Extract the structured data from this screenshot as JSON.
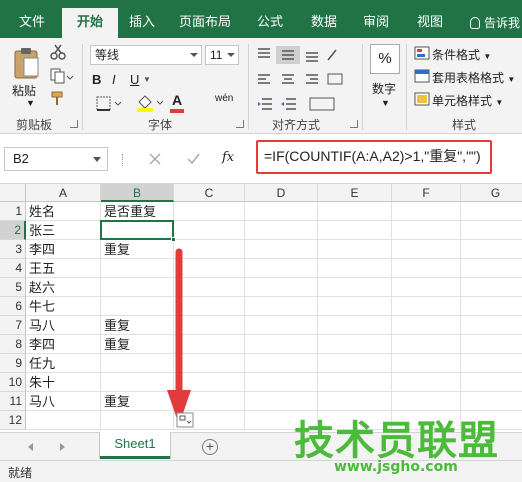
{
  "tabs": [
    "文件",
    "开始",
    "插入",
    "页面布局",
    "公式",
    "数据",
    "审阅",
    "视图"
  ],
  "tell_me": "告诉我",
  "ribbon": {
    "paste_label": "粘贴",
    "clipboard_label": "剪贴板",
    "font_name": "等线",
    "font_size": "11",
    "font_group_label": "字体",
    "bold": "B",
    "italic": "I",
    "underline": "U",
    "font_color": "A",
    "phonetic": "wén",
    "align_group_label": "对齐方式",
    "percent": "%",
    "number_label": "数字",
    "cond_format": "条件格式",
    "table_format": "套用表格格式",
    "cell_style": "单元格样式",
    "style_group_label": "样式",
    "fx": "fx"
  },
  "formula_bar": {
    "name_box": "B2",
    "formula": "=IF(COUNTIF(A:A,A2)>1,\"重复\",\"\")"
  },
  "columns": [
    "A",
    "B",
    "C",
    "D",
    "E",
    "F",
    "G"
  ],
  "rows": [
    {
      "num": "1",
      "a": "姓名",
      "b": "是否重复"
    },
    {
      "num": "2",
      "a": "张三",
      "b": ""
    },
    {
      "num": "3",
      "a": "李四",
      "b": "重复"
    },
    {
      "num": "4",
      "a": "王五",
      "b": ""
    },
    {
      "num": "5",
      "a": "赵六",
      "b": ""
    },
    {
      "num": "6",
      "a": "牛七",
      "b": ""
    },
    {
      "num": "7",
      "a": "马八",
      "b": "重复"
    },
    {
      "num": "8",
      "a": "李四",
      "b": "重复"
    },
    {
      "num": "9",
      "a": "任九",
      "b": ""
    },
    {
      "num": "10",
      "a": "朱十",
      "b": ""
    },
    {
      "num": "11",
      "a": "马八",
      "b": "重复"
    },
    {
      "num": "12",
      "a": "",
      "b": ""
    }
  ],
  "sheet_tab": "Sheet1",
  "add_sheet": "+",
  "status": "就绪",
  "watermark": {
    "logo": "技术员联盟",
    "url": "www.jsgho.com"
  },
  "colors": {
    "excel_green": "#217346",
    "highlight_red": "#e23b3b",
    "watermark_green": "#4cba3a"
  }
}
